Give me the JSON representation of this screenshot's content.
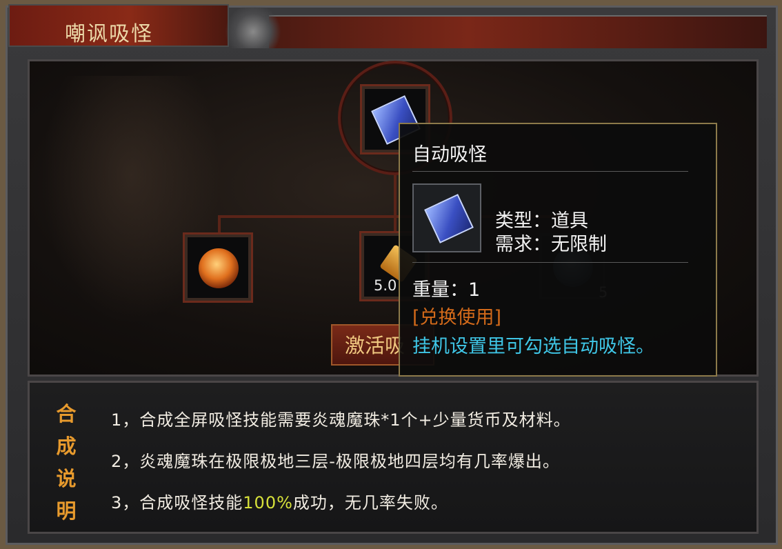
{
  "window": {
    "title": "嘲讽吸怪"
  },
  "slots": [
    {
      "name": "auto-absorb-book",
      "icon": "blue-book-icon"
    },
    {
      "name": "fire-soul-orb",
      "icon": "fire-orb-icon"
    },
    {
      "name": "gold-material",
      "icon": "gold-ingot-icon",
      "amount": "5.0"
    },
    {
      "name": "blue-orb",
      "icon": "blue-orb-icon",
      "amount": "5"
    }
  ],
  "activate_button": {
    "label": "激活吸"
  },
  "tooltip": {
    "title": "自动吸怪",
    "type_line": "类型：道具",
    "req_line": "需求：无限制",
    "weight_line": "重量：1",
    "action_line": "[兑换使用]",
    "desc_line": "挂机设置里可勾选自动吸怪。"
  },
  "description": {
    "title": [
      "合",
      "成",
      "说",
      "明"
    ],
    "line1": "1，合成全屏吸怪技能需要炎魂魔珠*1个+少量货币及材料。",
    "line2": "2，炎魂魔珠在极限极地三层-极限极地四层均有几率爆出。",
    "line3_pre": "3，合成吸怪技能",
    "line3_hl": "100%",
    "line3_post": "成功，无几率失败。"
  },
  "colors": {
    "orange_text": "#d36a1a",
    "cyan_text": "#3fc6e6",
    "highlight": "#d8e23a",
    "desc_title": "#e79a2d"
  }
}
